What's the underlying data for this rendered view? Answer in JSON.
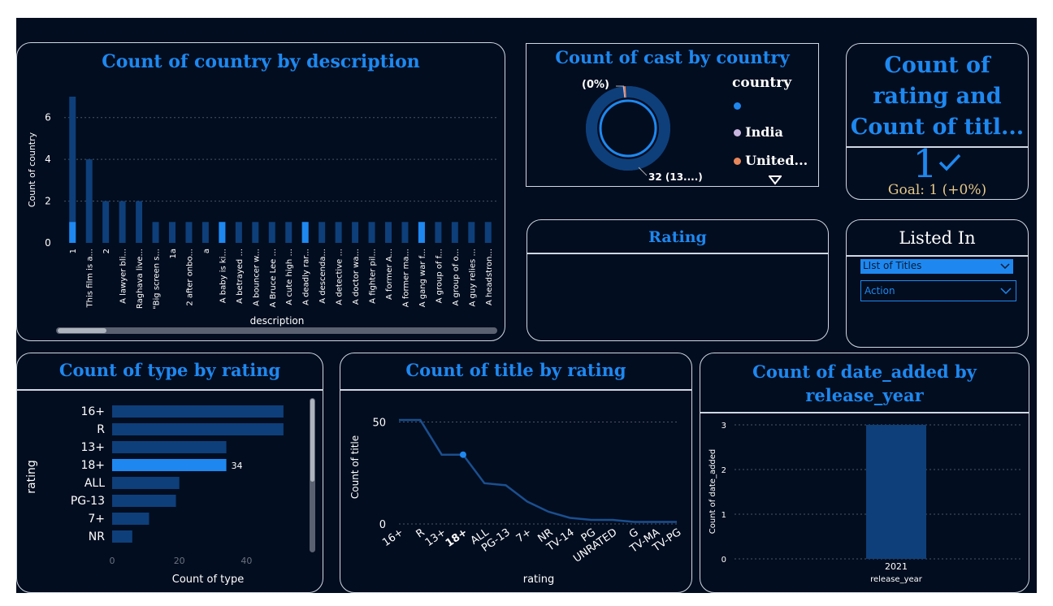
{
  "colors": {
    "background": "#020d1f",
    "panel_border": "#cfd8e3",
    "title": "#1e88f0",
    "bar_dark": "#0e3f7a",
    "bar_highlight": "#1e88f0",
    "line": "#1b4f8f",
    "goal_text": "#e6c98a",
    "select_highlight": "#1e88f0"
  },
  "panels": {
    "country_by_description": {
      "title": "Count of country by description",
      "xlabel": "description",
      "ylabel": "Count of country"
    },
    "cast_by_country": {
      "title": "Count of cast by country",
      "legend_title": "country",
      "legend_items": [
        "",
        "India",
        "United..."
      ],
      "legend_colors": [
        "#1e88f0",
        "#c9b6e0",
        "#e8875a"
      ],
      "label_top": "(0%)",
      "label_bottom": "32 (13....)"
    },
    "kpi": {
      "title": "Count of rating and Count of titl...",
      "value": "1",
      "check_icon": "checkmark-icon",
      "goal": "Goal: 1 (+0%)"
    },
    "rating_slicer": {
      "title": "Rating"
    },
    "listed_in": {
      "title": "Listed In",
      "select1_value": "LIst of Titles",
      "select2_value": "Action",
      "chevron_icon": "chevron-down-icon"
    },
    "type_by_rating": {
      "title": "Count of type by rating",
      "xlabel": "Count of type",
      "ylabel": "rating",
      "data_label": "34"
    },
    "title_by_rating": {
      "title": "Count of title by rating",
      "xlabel": "rating",
      "ylabel": "Count of title"
    },
    "date_added_by_year": {
      "title": "Count of date_added by release_year",
      "xlabel": "release_year",
      "ylabel": "Count of date_added"
    }
  },
  "chart_data": [
    {
      "type": "bar",
      "title": "Count of country by description",
      "xlabel": "description",
      "ylabel": "Count of country",
      "ylim": [
        0,
        7
      ],
      "yticks": [
        0,
        2,
        4,
        6
      ],
      "grid": true,
      "categories": [
        "1",
        "This film is a...",
        "2",
        "A lawyer bli...",
        "Raghava live...",
        "\"Big screen s...",
        "1a",
        "2 after onbo...",
        "a",
        "A baby is ki...",
        "A betrayed ...",
        "A bouncer w...",
        "A Bruce Lee ...",
        "A cute high ...",
        "A deadly rar...",
        "A descenda...",
        "A detective ...",
        "A doctor wa...",
        "A fighter pil...",
        "A former A...",
        "A former ma...",
        "A gang war f...",
        "A group of f...",
        "A group of o...",
        "A guy relies ...",
        "A headstron..."
      ],
      "series": [
        {
          "values": [
            7,
            4,
            2,
            2,
            2,
            1,
            1,
            1,
            1,
            1,
            1,
            1,
            1,
            1,
            1,
            1,
            1,
            1,
            1,
            1,
            1,
            1,
            1,
            1,
            1,
            1
          ]
        },
        {
          "values": [
            1,
            0,
            0,
            0,
            0,
            0,
            0,
            0,
            0,
            1,
            0,
            0,
            0,
            0,
            1,
            0,
            0,
            0,
            0,
            0,
            0,
            1,
            0,
            0,
            0,
            0
          ]
        }
      ]
    },
    {
      "type": "pie",
      "title": "Count of cast by country",
      "donut": true,
      "slices": [
        {
          "label": "",
          "value": 99.0
        },
        {
          "label": "India",
          "value": 0.4
        },
        {
          "label": "United...",
          "value": 0.6
        }
      ]
    },
    {
      "type": "bar",
      "orientation": "horizontal",
      "title": "Count of type by rating",
      "xlabel": "Count of type",
      "ylabel": "rating",
      "xlim": [
        0,
        52
      ],
      "xticks": [
        0,
        20,
        40
      ],
      "categories": [
        "16+",
        "R",
        "13+",
        "18+",
        "ALL",
        "PG-13",
        "7+",
        "NR"
      ],
      "values": [
        51,
        51,
        34,
        34,
        20,
        19,
        11,
        6
      ],
      "highlight": "18+"
    },
    {
      "type": "line",
      "title": "Count of title by rating",
      "xlabel": "rating",
      "ylabel": "Count of title",
      "ylim": [
        0,
        55
      ],
      "yticks": [
        0,
        50
      ],
      "grid": true,
      "x": [
        "16+",
        "R",
        "13+",
        "18+",
        "ALL",
        "PG-13",
        "7+",
        "NR",
        "TV-14",
        "PG",
        "UNRATED",
        "G",
        "TV-MA",
        "TV-PG"
      ],
      "values": [
        51,
        51,
        34,
        34,
        20,
        19,
        11,
        6,
        3,
        2,
        2,
        1,
        1,
        1
      ],
      "highlight": "18+"
    },
    {
      "type": "bar",
      "title": "Count of date_added by release_year",
      "xlabel": "release_year",
      "ylabel": "Count of date_added",
      "ylim": [
        0,
        3
      ],
      "yticks": [
        0,
        1,
        2,
        3
      ],
      "grid": true,
      "categories": [
        "2021"
      ],
      "values": [
        3
      ]
    }
  ]
}
